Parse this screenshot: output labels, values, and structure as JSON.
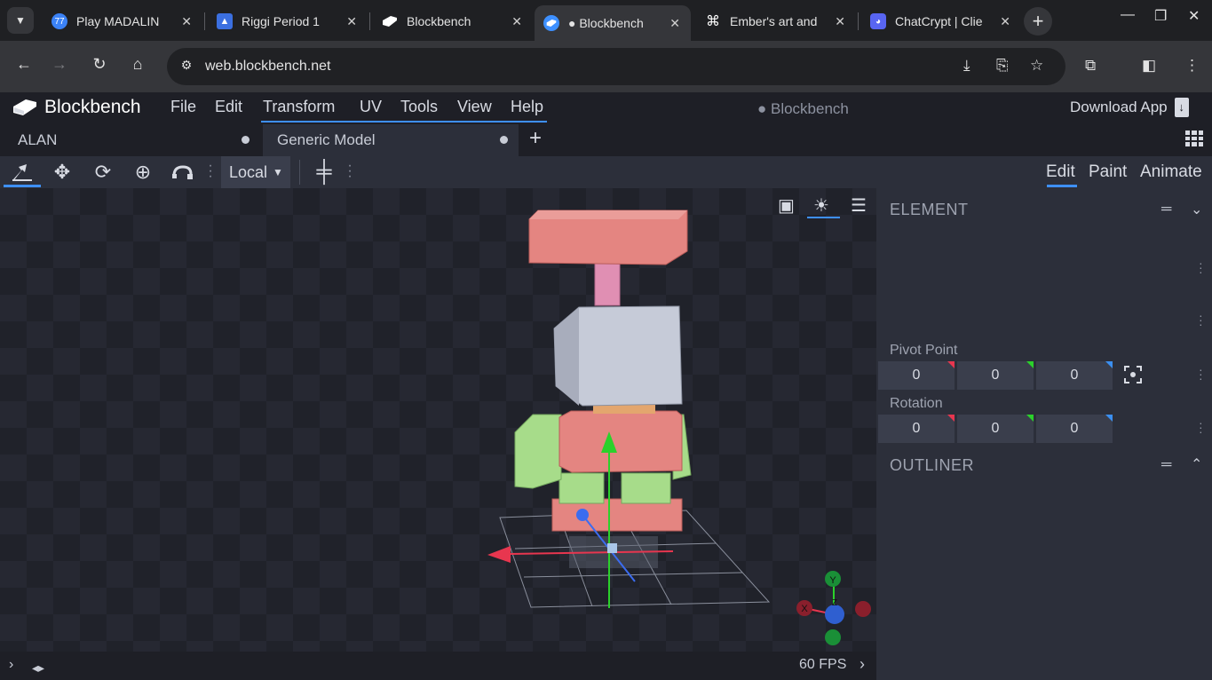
{
  "browser": {
    "tabs": [
      {
        "title": "Play MADALIN",
        "favicon": "77",
        "color": "#3b82f6"
      },
      {
        "title": "Riggi Period 1",
        "favicon": "person-icon",
        "color": "#3b6fe0"
      },
      {
        "title": "Blockbench",
        "favicon": "blockbench-icon",
        "color": "#ffffff"
      },
      {
        "title": "● Blockbench",
        "favicon": "blockbench-icon",
        "color": "#3e90ff"
      },
      {
        "title": "Ember's art and",
        "favicon": "ember-icon",
        "color": "#ffffff"
      },
      {
        "title": "ChatCrypt | Clie",
        "favicon": "discord-icon",
        "color": "#5865f2"
      }
    ],
    "url": "web.blockbench.net"
  },
  "app": {
    "name": "Blockbench",
    "menu": [
      "File",
      "Edit",
      "Transform",
      "UV",
      "Tools",
      "View",
      "Help"
    ],
    "project_title": "● Blockbench",
    "download_label": "Download App",
    "project_tabs": [
      {
        "label": "ALAN"
      },
      {
        "label": "Generic Model"
      }
    ],
    "toolbar": {
      "space_select": "Local",
      "modes": [
        "Edit",
        "Paint",
        "Animate"
      ]
    },
    "viewport": {
      "fps": "60 FPS",
      "axes": {
        "x": "X",
        "y": "Y",
        "z": "Z"
      }
    },
    "panel": {
      "element_title": "ELEMENT",
      "pivot_label": "Pivot Point",
      "pivot": [
        "0",
        "0",
        "0"
      ],
      "rotation_label": "Rotation",
      "rotation": [
        "0",
        "0",
        "0"
      ],
      "outliner_title": "OUTLINER"
    },
    "colors": {
      "accent": "#3e90ff",
      "axis_x": "#e8364f",
      "axis_y": "#2bd12b",
      "axis_z": "#3b6cf0"
    }
  }
}
